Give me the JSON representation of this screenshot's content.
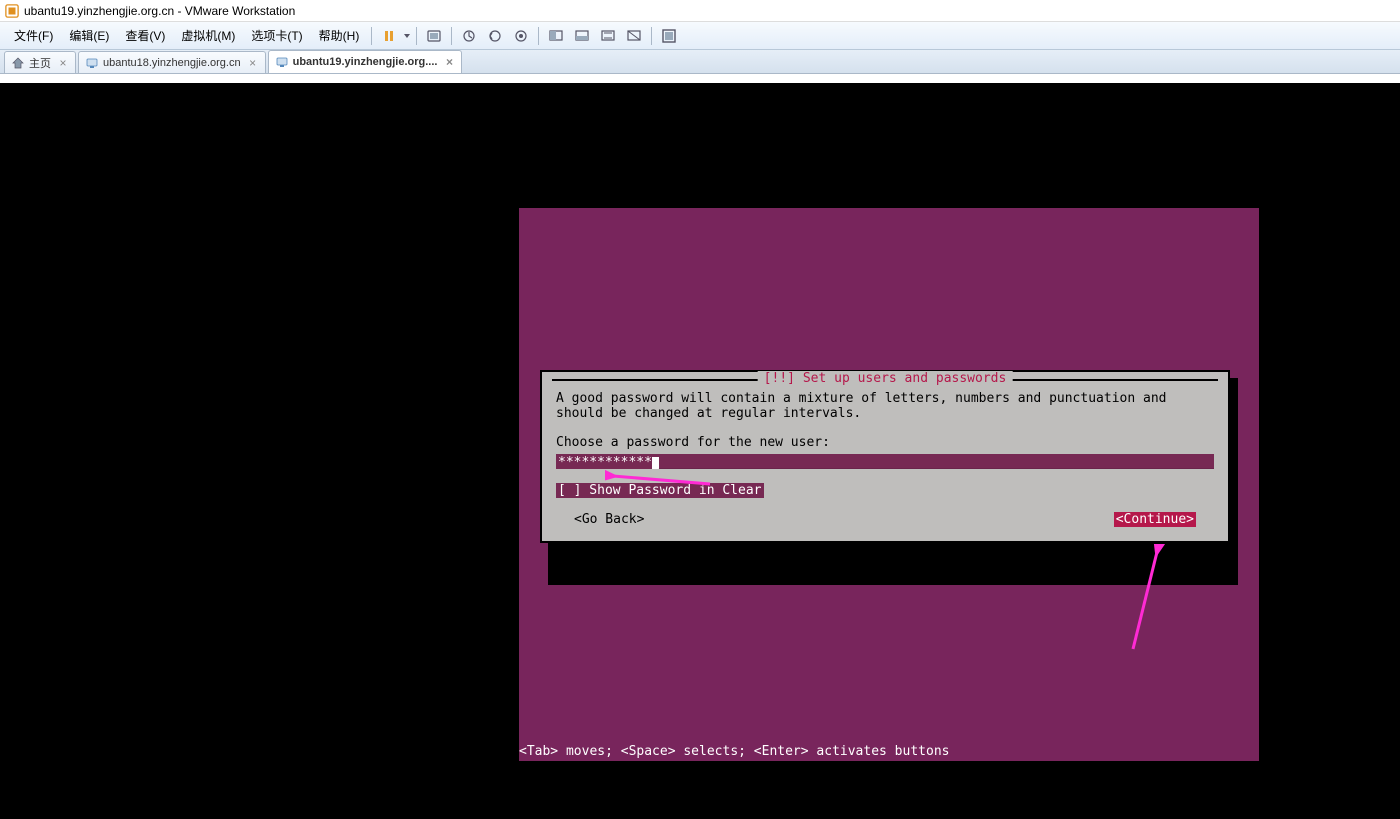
{
  "window": {
    "title": "ubantu19.yinzhengjie.org.cn - VMware Workstation"
  },
  "menu": {
    "file": "文件(F)",
    "edit": "编辑(E)",
    "view": "查看(V)",
    "vm": "虚拟机(M)",
    "tabs": "选项卡(T)",
    "help": "帮助(H)"
  },
  "tabs": [
    {
      "label": "主页",
      "icon": "home"
    },
    {
      "label": "ubantu18.yinzhengjie.org.cn",
      "icon": "vm"
    },
    {
      "label": "ubantu19.yinzhengjie.org....",
      "icon": "vm",
      "active": true
    }
  ],
  "installer": {
    "title": "[!!] Set up users and passwords",
    "description": "A good password will contain a mixture of letters, numbers and punctuation and should be changed at regular intervals.",
    "prompt": "Choose a password for the new user:",
    "password_mask": "************",
    "show_pw_label": "[ ] Show Password in Clear",
    "go_back": "<Go Back>",
    "continue": "<Continue>",
    "help_line": "<Tab> moves; <Space> selects; <Enter> activates buttons"
  }
}
